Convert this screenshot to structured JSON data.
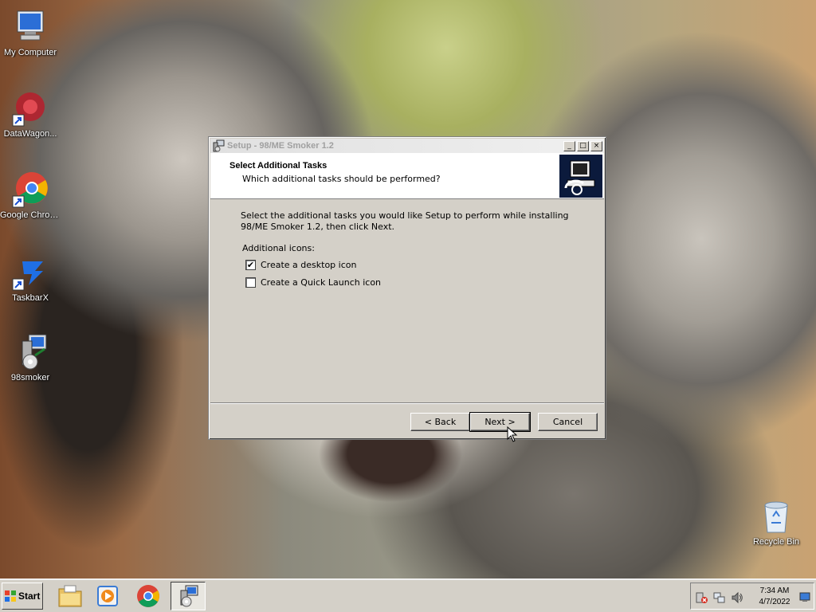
{
  "desktop": {
    "icons": [
      {
        "label": "My Computer",
        "icon": "computer-icon"
      },
      {
        "label": "DataWagon...",
        "icon": "datawagon-icon"
      },
      {
        "label": "Google Chrome",
        "icon": "chrome-icon"
      },
      {
        "label": "TaskbarX",
        "icon": "taskbarx-icon"
      },
      {
        "label": "98smoker",
        "icon": "installer-icon"
      },
      {
        "label": "Recycle Bin",
        "icon": "recycle-bin-icon"
      }
    ]
  },
  "dialog": {
    "title": "Setup - 98/ME Smoker 1.2",
    "controls": {
      "minimize": "_",
      "maximize": "□",
      "close": "×"
    },
    "header_title": "Select Additional Tasks",
    "header_subtitle": "Which additional tasks should be performed?",
    "body_text": "Select the additional tasks you would like Setup to perform while installing 98/ME Smoker 1.2, then click Next.",
    "additional_icons_label": "Additional icons:",
    "options": [
      {
        "label": "Create a desktop icon",
        "checked": true
      },
      {
        "label": "Create a Quick Launch icon",
        "checked": false
      }
    ],
    "buttons": {
      "back": "< Back",
      "next": "Next >",
      "cancel": "Cancel"
    }
  },
  "taskbar": {
    "start_label": "Start",
    "apps": [
      "file-explorer-icon",
      "media-player-icon",
      "chrome-icon",
      "installer-icon"
    ],
    "tray_icons": [
      "network-error-icon",
      "network-icon",
      "volume-icon"
    ],
    "time": "7:34 AM",
    "date": "4/7/2022"
  }
}
